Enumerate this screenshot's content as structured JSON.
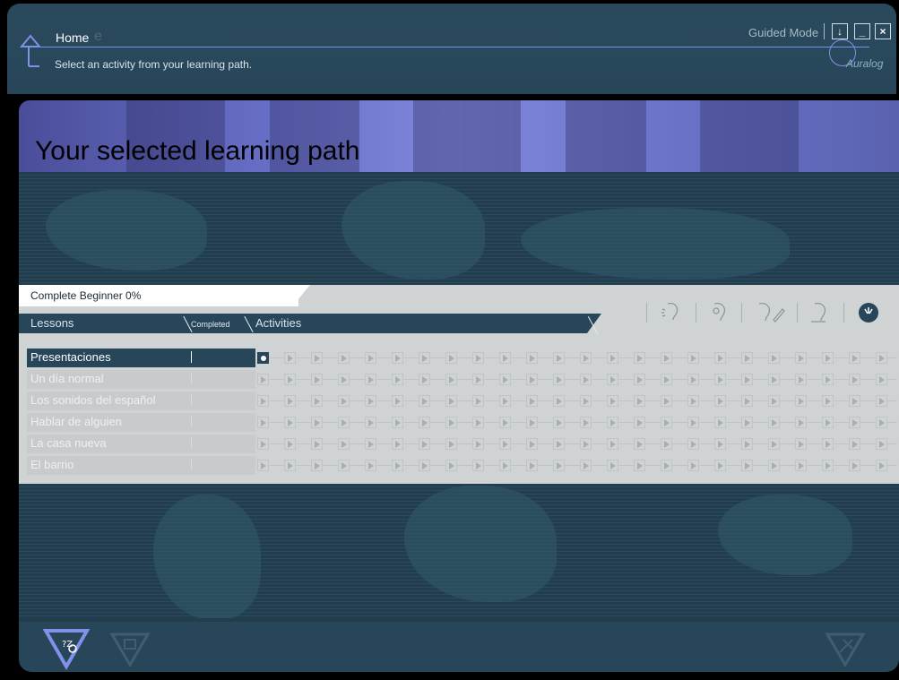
{
  "header": {
    "title": "Home",
    "title_ghost": "e",
    "subtitle": "Select an activity from your learning path.",
    "mode_label": "Guided Mode",
    "download_button": "↓",
    "minimize_button": "_",
    "close_button": "×",
    "logo": "Auralog"
  },
  "banner": {
    "title": "Your selected learning path"
  },
  "panel": {
    "path_label": "Complete Beginner 0%",
    "lessons_label": "Lessons",
    "completed_label": "Completed",
    "activities_label": "Activities",
    "activity_icons": [
      "listening-icon",
      "comprehension-icon",
      "writing-icon",
      "speaking-icon",
      "pronunciation-icon"
    ],
    "lessons": [
      {
        "label": "Presentaciones",
        "active": true
      },
      {
        "label": "Un día normal",
        "active": false
      },
      {
        "label": "Los sonidos del español",
        "active": false
      },
      {
        "label": "Hablar de alguien",
        "active": false
      },
      {
        "label": "La casa nueva",
        "active": false
      },
      {
        "label": "El barrio",
        "active": false
      }
    ],
    "activities_per_lesson": 24,
    "current_activity": 1
  },
  "footer": {
    "icons": [
      "test-icon",
      "dictionary-icon",
      "tools-icon"
    ]
  },
  "colors": {
    "header_bg": "#27465a",
    "accent_line": "#8190e8",
    "banner": "#6970c8",
    "panel_bg": "#cfd3d4",
    "active_row": "#27465a"
  }
}
